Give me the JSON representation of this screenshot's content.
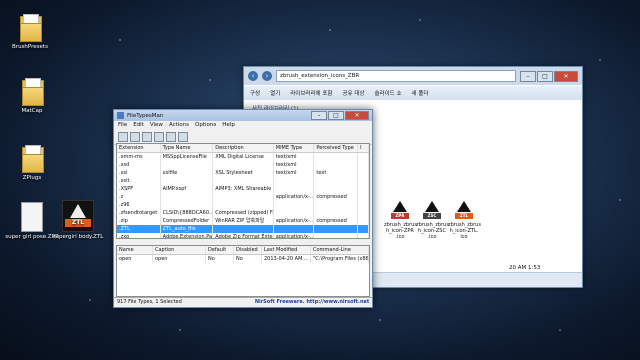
{
  "desktop": {
    "icons": [
      {
        "label": "BrushPresets"
      },
      {
        "label": "MatCap"
      },
      {
        "label": "ZPlugs"
      },
      {
        "label": "super girl pose.ZPR"
      },
      {
        "label": "supergirl body.ZTL"
      }
    ],
    "ztl_badge": "ZTL"
  },
  "explorer": {
    "address": "zbrush_extension_icons_ZBR",
    "toolbar": [
      "구성",
      "열기",
      "라이브러리에 포함",
      "공유 대상",
      "슬라이드 쇼",
      "새 폴더"
    ],
    "library_header": "사진 라이브러리 (1)",
    "files": [
      {
        "name": "zbrush_zbrus h_icon-ZPR .ico",
        "badge": "ZPR"
      },
      {
        "name": "zbrush_zbrus h_icon-ZSC .ico",
        "badge": "ZSC"
      },
      {
        "name": "zbrush_zbrus h_icon-ZTL. ico",
        "badge": "ZTL"
      }
    ],
    "status_time": "20 AM 1:53"
  },
  "ftm": {
    "title": "FileTypesMan",
    "menu": [
      "File",
      "Edit",
      "View",
      "Actions",
      "Options",
      "Help"
    ],
    "columns": [
      "Extension",
      "Type Name",
      "Description",
      "MIME Type",
      "Perceived Type",
      "I"
    ],
    "rows": [
      [
        ".xmm-ms",
        "MSSppLicenseFile",
        "XML Digital License",
        "text/xml",
        "",
        ""
      ],
      [
        ".xsd",
        "",
        "",
        "text/xml",
        "",
        ""
      ],
      [
        ".xsl",
        "xslfile",
        "XSL Stylesheet",
        "text/xml",
        "text",
        ""
      ],
      [
        ".xslt",
        "",
        "",
        "",
        "",
        ""
      ],
      [
        ".XSPF",
        "AIMP.xspf",
        "AIMP3: XML Shareable ...",
        "",
        "",
        ""
      ],
      [
        ".z",
        "",
        "",
        "application/x-...",
        "compressed",
        ""
      ],
      [
        ".z96",
        "",
        "",
        "",
        "",
        ""
      ],
      [
        ".zfsendtotarget",
        "CLSID\\{888DCA60...",
        "Compressed (zipped) F...",
        "",
        "",
        ""
      ],
      [
        ".zip",
        "CompressedFolder",
        "WinRAR ZIP 압축파일",
        "application/x-...",
        "compressed",
        ""
      ],
      [
        ".ZTL",
        "ZTL_auto_file",
        "",
        "",
        "",
        ""
      ],
      [
        ".zxp",
        "Adobe.Extension.Pa...",
        "Adobe Zip Format Exte...",
        "application/x-...",
        "",
        ""
      ]
    ],
    "selected_row": 9,
    "actions_columns": [
      "Name",
      "Caption",
      "Default",
      "Disabled",
      "Last Modified",
      "Command-Line"
    ],
    "actions_rows": [
      [
        "open",
        "open",
        "No",
        "No",
        "2013-04-20 AM ...",
        "\"C:\\Program Files (x86)\\..."
      ]
    ],
    "status_count": "917 File Types, 1 Selected",
    "status_nirsoft": "NirSoft Freeware.  http://www.nirsoft.net"
  }
}
